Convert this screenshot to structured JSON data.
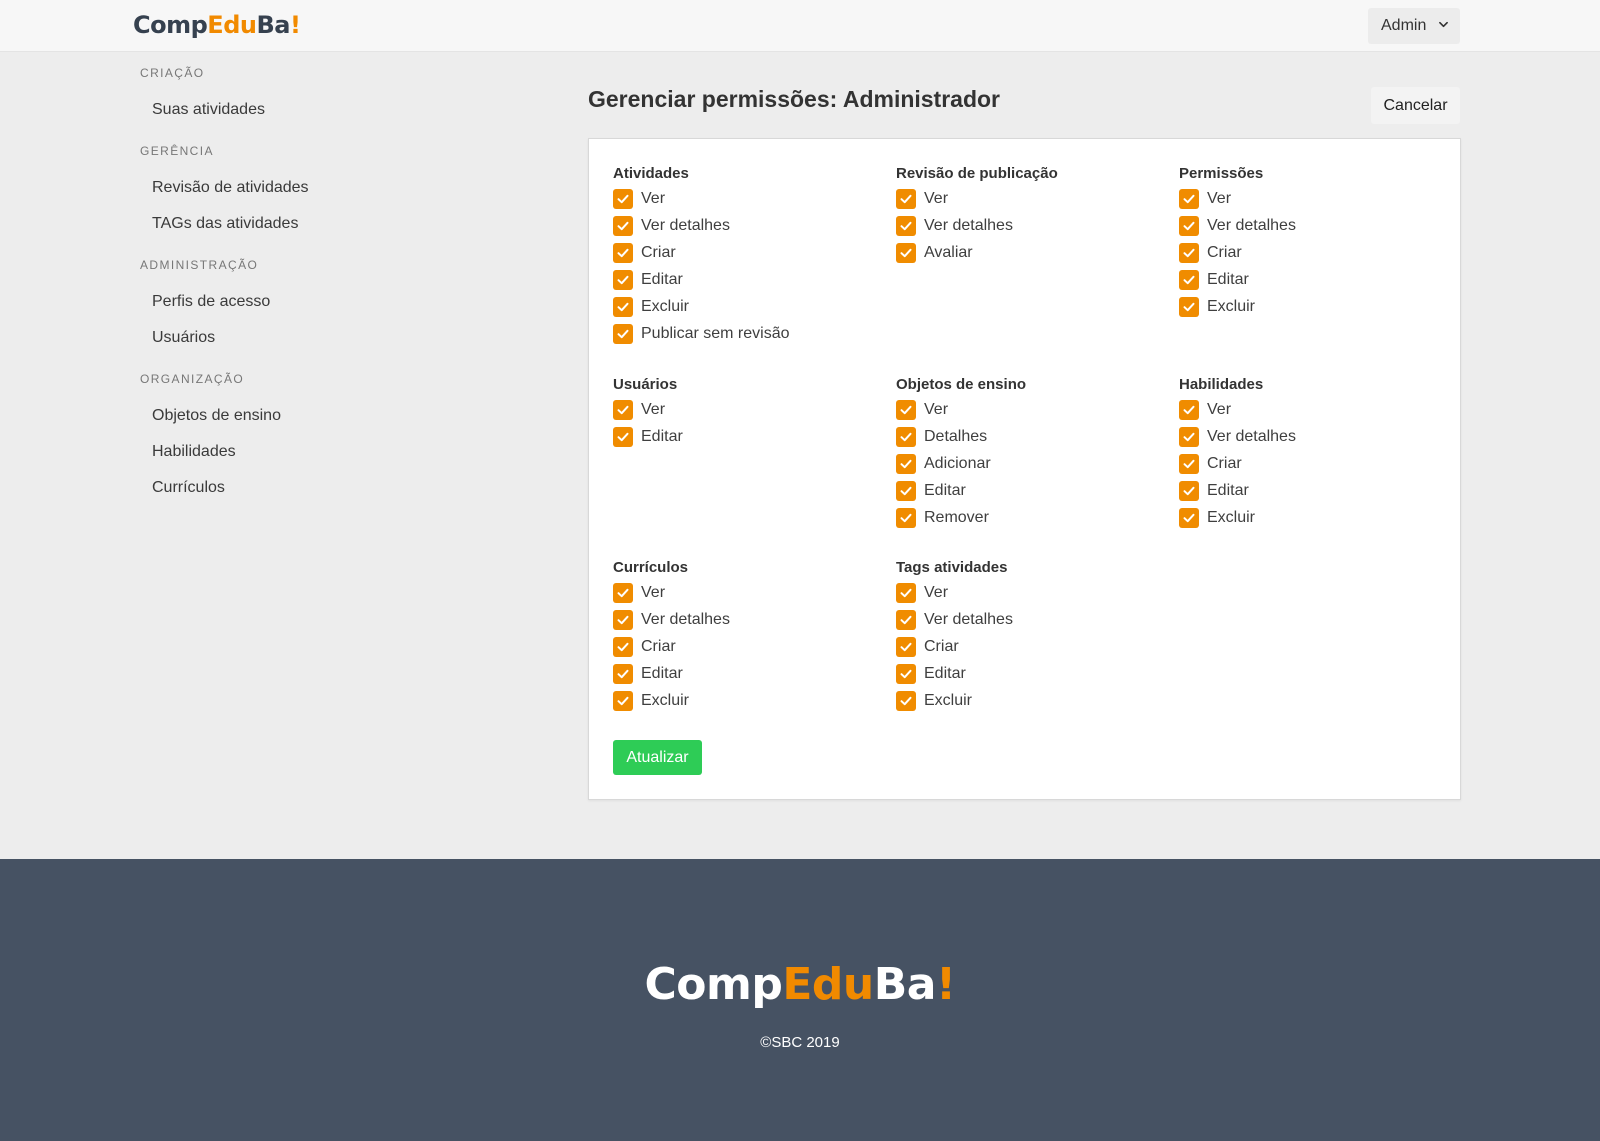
{
  "brand": {
    "part1": "Comp",
    "part2": "Edu",
    "part3": "Ba",
    "part4": "!",
    "accent_color": "#f18a00",
    "dark_color": "#36414f"
  },
  "header": {
    "user_menu_label": "Admin",
    "user_menu_icon": "chevron-down-icon"
  },
  "sidebar": {
    "sections": [
      {
        "heading": "CRIAÇÃO",
        "items": [
          "Suas atividades"
        ]
      },
      {
        "heading": "GERÊNCIA",
        "items": [
          "Revisão de atividades",
          "TAGs das atividades"
        ]
      },
      {
        "heading": "ADMINISTRAÇÃO",
        "items": [
          "Perfis de acesso",
          "Usuários"
        ]
      },
      {
        "heading": "ORGANIZAÇÃO",
        "items": [
          "Objetos de ensino",
          "Habilidades",
          "Currículos"
        ]
      }
    ]
  },
  "main": {
    "title": "Gerenciar permissões: Administrador",
    "cancel_label": "Cancelar",
    "update_label": "Atualizar",
    "checkbox_color": "#f08c00",
    "update_color": "#2ecc56",
    "groups": [
      {
        "title": "Atividades",
        "permissions": [
          {
            "label": "Ver",
            "checked": true
          },
          {
            "label": "Ver detalhes",
            "checked": true
          },
          {
            "label": "Criar",
            "checked": true
          },
          {
            "label": "Editar",
            "checked": true
          },
          {
            "label": "Excluir",
            "checked": true
          },
          {
            "label": "Publicar sem revisão",
            "checked": true
          }
        ]
      },
      {
        "title": "Revisão de publicação",
        "permissions": [
          {
            "label": "Ver",
            "checked": true
          },
          {
            "label": "Ver detalhes",
            "checked": true
          },
          {
            "label": "Avaliar",
            "checked": true
          }
        ]
      },
      {
        "title": "Permissões",
        "permissions": [
          {
            "label": "Ver",
            "checked": true
          },
          {
            "label": "Ver detalhes",
            "checked": true
          },
          {
            "label": "Criar",
            "checked": true
          },
          {
            "label": "Editar",
            "checked": true
          },
          {
            "label": "Excluir",
            "checked": true
          }
        ]
      },
      {
        "title": "Usuários",
        "permissions": [
          {
            "label": "Ver",
            "checked": true
          },
          {
            "label": "Editar",
            "checked": true
          }
        ]
      },
      {
        "title": "Objetos de ensino",
        "permissions": [
          {
            "label": "Ver",
            "checked": true
          },
          {
            "label": "Detalhes",
            "checked": true
          },
          {
            "label": "Adicionar",
            "checked": true
          },
          {
            "label": "Editar",
            "checked": true
          },
          {
            "label": "Remover",
            "checked": true
          }
        ]
      },
      {
        "title": "Habilidades",
        "permissions": [
          {
            "label": "Ver",
            "checked": true
          },
          {
            "label": "Ver detalhes",
            "checked": true
          },
          {
            "label": "Criar",
            "checked": true
          },
          {
            "label": "Editar",
            "checked": true
          },
          {
            "label": "Excluir",
            "checked": true
          }
        ]
      },
      {
        "title": "Currículos",
        "permissions": [
          {
            "label": "Ver",
            "checked": true
          },
          {
            "label": "Ver detalhes",
            "checked": true
          },
          {
            "label": "Criar",
            "checked": true
          },
          {
            "label": "Editar",
            "checked": true
          },
          {
            "label": "Excluir",
            "checked": true
          }
        ]
      },
      {
        "title": "Tags atividades",
        "permissions": [
          {
            "label": "Ver",
            "checked": true
          },
          {
            "label": "Ver detalhes",
            "checked": true
          },
          {
            "label": "Criar",
            "checked": true
          },
          {
            "label": "Editar",
            "checked": true
          },
          {
            "label": "Excluir",
            "checked": true
          }
        ]
      }
    ]
  },
  "footer": {
    "copyright": "©SBC 2019",
    "background_color": "#465263"
  }
}
